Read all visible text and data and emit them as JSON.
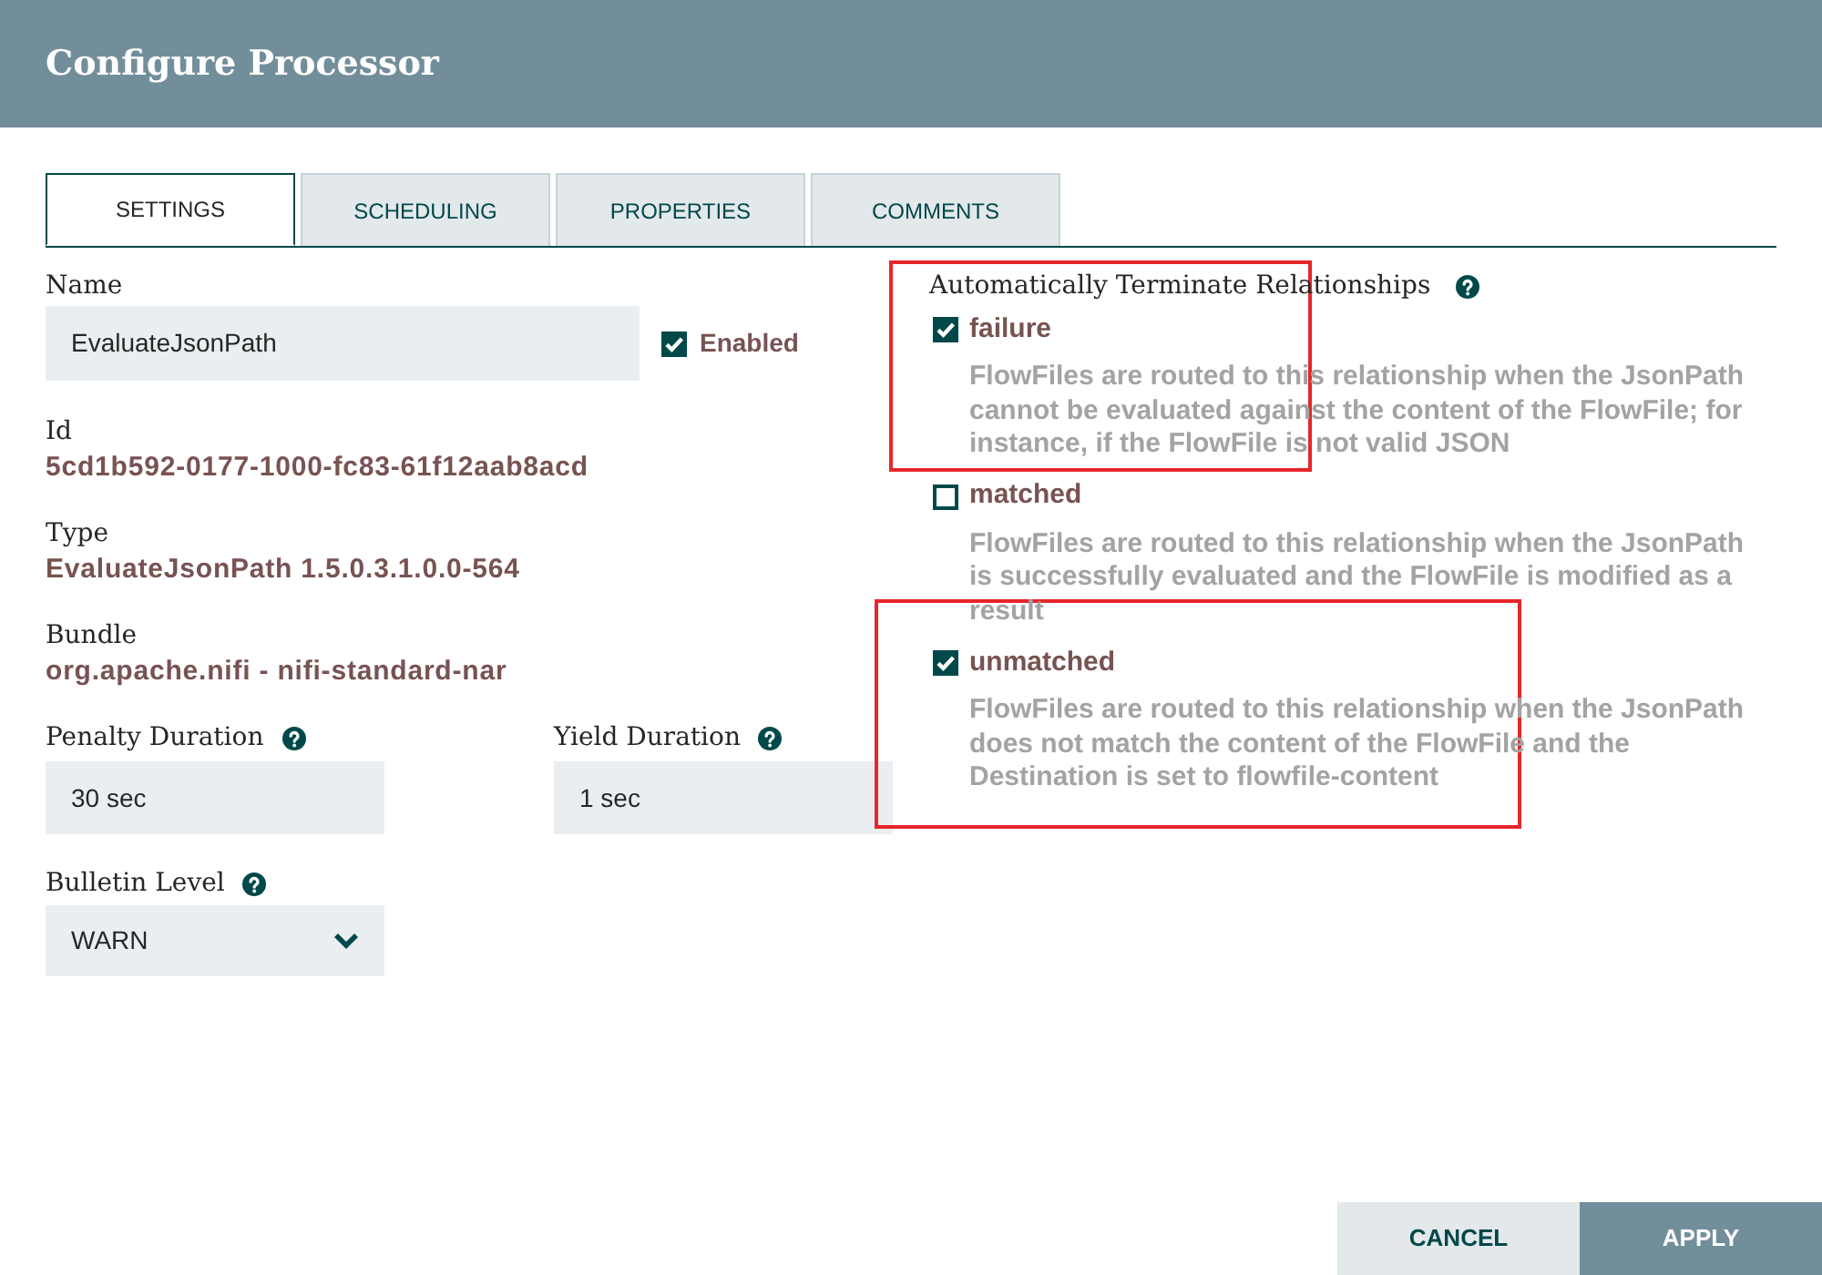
{
  "window": {
    "title": "Configure Processor"
  },
  "tabs": [
    {
      "label": "SETTINGS",
      "selected": true
    },
    {
      "label": "SCHEDULING",
      "selected": false
    },
    {
      "label": "PROPERTIES",
      "selected": false
    },
    {
      "label": "COMMENTS",
      "selected": false
    }
  ],
  "settings": {
    "name": {
      "label": "Name",
      "value": "EvaluateJsonPath"
    },
    "enabled": {
      "label": "Enabled",
      "checked": true
    },
    "info": [
      {
        "label": "Id",
        "value": "5cd1b592-0177-1000-fc83-61f12aab8acd"
      },
      {
        "label": "Type",
        "value": "EvaluateJsonPath 1.5.0.3.1.0.0-564"
      },
      {
        "label": "Bundle",
        "value": "org.apache.nifi - nifi-standard-nar"
      }
    ],
    "penalty_duration": {
      "label": "Penalty Duration",
      "value": "30 sec"
    },
    "yield_duration": {
      "label": "Yield Duration",
      "value": "1 sec"
    },
    "bulletin_level": {
      "label": "Bulletin Level",
      "value": "WARN"
    }
  },
  "relationships": {
    "title": "Automatically Terminate Relationships",
    "items": [
      {
        "name": "failure",
        "checked": true,
        "highlighted": true,
        "description": "FlowFiles are routed to this relationship when the JsonPath cannot be evaluated against the content of the FlowFile; for instance, if the FlowFile is not valid JSON"
      },
      {
        "name": "matched",
        "checked": false,
        "highlighted": false,
        "description": "FlowFiles are routed to this relationship when the JsonPath is successfully evaluated and the FlowFile is modified as a result"
      },
      {
        "name": "unmatched",
        "checked": true,
        "highlighted": true,
        "description": "FlowFiles are routed to this relationship when the JsonPath does not match the content of the FlowFile and the Destination is set to flowfile-content"
      }
    ]
  },
  "buttons": [
    {
      "label": "CANCEL",
      "kind": "secondary"
    },
    {
      "label": "APPLY",
      "kind": "primary"
    }
  ]
}
